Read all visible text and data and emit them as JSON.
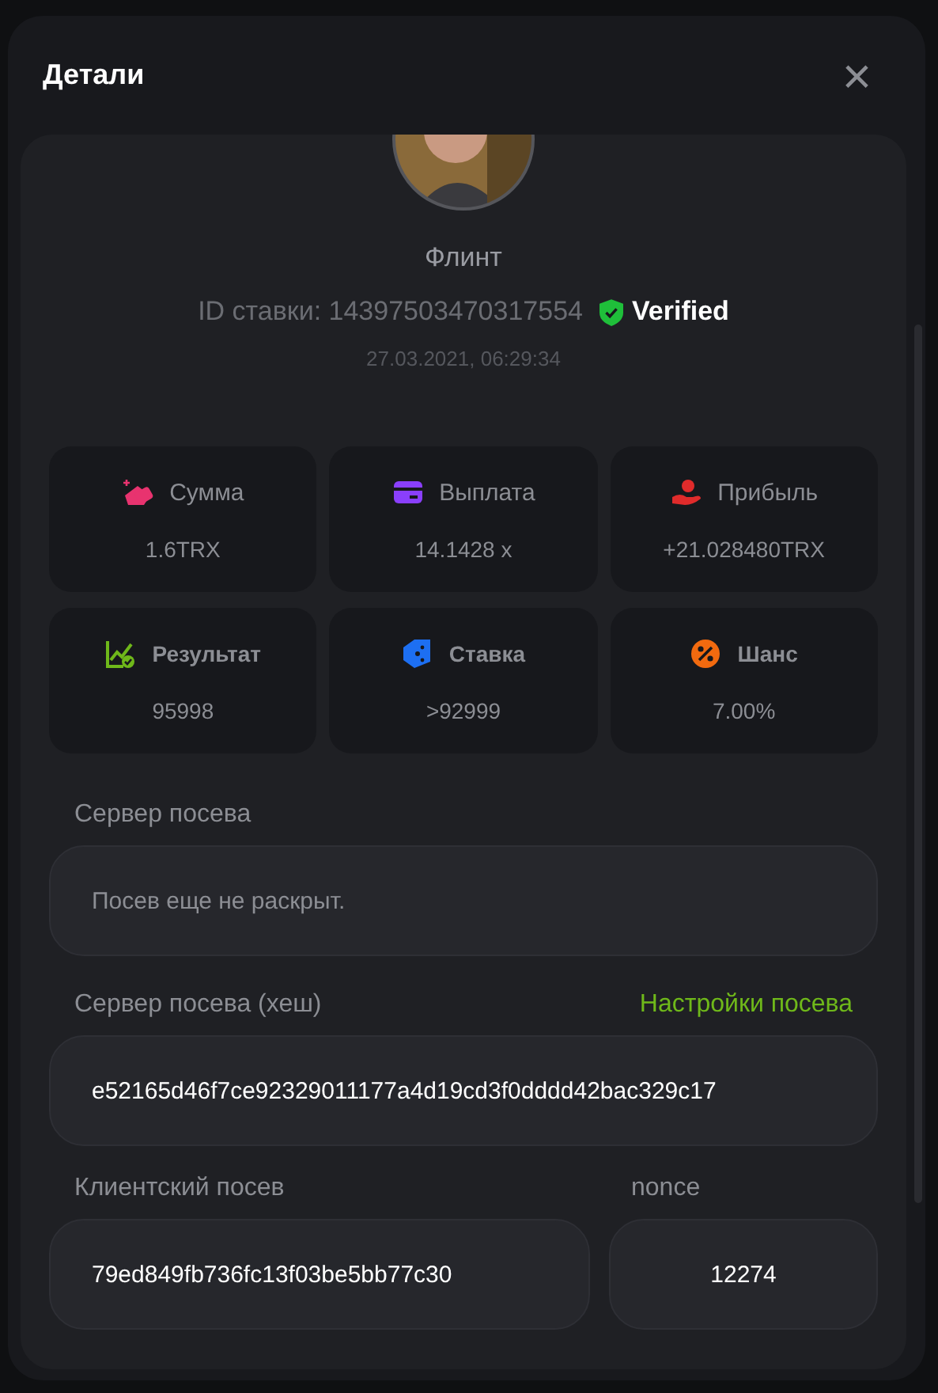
{
  "dialog": {
    "title": "Детали",
    "close": "×"
  },
  "bet": {
    "user": "Флинт",
    "id_label": "ID ставки: 14397503470317554",
    "verified": true,
    "verified_label": "Verified",
    "date": "27.03.2021, 06:29:34"
  },
  "stats": [
    {
      "kind": "coins",
      "color": "#e8336f",
      "label": "Сумма",
      "bold": false,
      "value": "1.6TRX"
    },
    {
      "kind": "card",
      "color": "#8a3ffc",
      "label": "Выплата",
      "bold": false,
      "value": "14.1428 x"
    },
    {
      "kind": "hand",
      "color": "#e02b2b",
      "label": "Прибыль",
      "bold": false,
      "value": "+21.028480TRX"
    },
    {
      "kind": "chart",
      "color": "#6fb81a",
      "label": "Результат",
      "bold": true,
      "value": "95998"
    },
    {
      "kind": "ticket",
      "color": "#1d6ff2",
      "label": "Ставка",
      "bold": true,
      "value": ">92999"
    },
    {
      "kind": "percent",
      "color": "#f26a0f",
      "label": "Шанс",
      "bold": true,
      "value": "7.00%"
    }
  ],
  "server_seed": {
    "label": "Сервер посева",
    "placeholder": "Посев еще не раскрыт."
  },
  "server_hash": {
    "label": "Сервер посева (хеш)",
    "link": "Настройки посева",
    "value": "e52165d46f7ce92329011177a4d19cd3f0dddd42bac329c17"
  },
  "client_seed": {
    "label": "Клиентский посев",
    "value": "79ed849fb736fc13f03be5bb77c30"
  },
  "nonce": {
    "label": "nonce",
    "value": "12274"
  }
}
